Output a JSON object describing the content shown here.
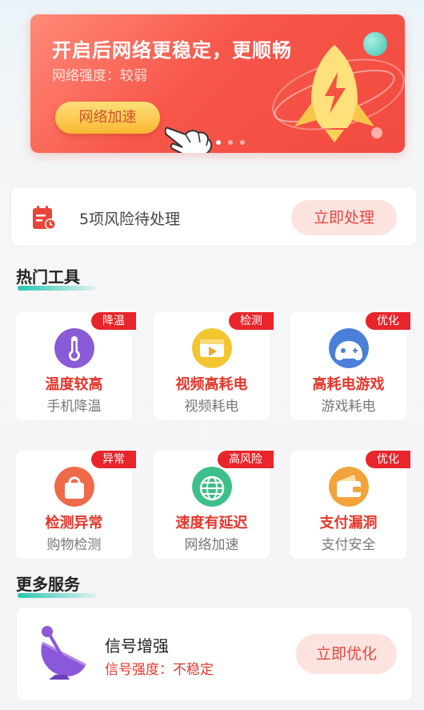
{
  "banner": {
    "title": "开启后网络更稳定，更顺畅",
    "subtitle": "网络强度：较弱",
    "button": "网络加速",
    "page_count": 3,
    "active_page": 1
  },
  "risk": {
    "text": "5项风险待处理",
    "button": "立即处理"
  },
  "sections": {
    "hot_tools": "热门工具",
    "more_services": "更多服务"
  },
  "tools": [
    {
      "tag": "降温",
      "name": "温度较高",
      "sub": "手机降温",
      "icon": "thermometer-icon",
      "color": "#8a5bd6"
    },
    {
      "tag": "检测",
      "name": "视频高耗电",
      "sub": "视频耗电",
      "icon": "video-icon",
      "color": "#f3c531"
    },
    {
      "tag": "优化",
      "name": "高耗电游戏",
      "sub": "游戏耗电",
      "icon": "gamepad-icon",
      "color": "#4a7fd9"
    },
    {
      "tag": "异常",
      "name": "检测异常",
      "sub": "购物检测",
      "icon": "shopping-bag-icon",
      "color": "#ee6a4a"
    },
    {
      "tag": "高风险",
      "name": "速度有延迟",
      "sub": "网络加速",
      "icon": "globe-icon",
      "color": "#3dbf8a"
    },
    {
      "tag": "优化",
      "name": "支付漏洞",
      "sub": "支付安全",
      "icon": "wallet-icon",
      "color": "#f2a33a"
    }
  ],
  "service": {
    "name": "信号增强",
    "status": "信号强度：不稳定",
    "button": "立即优化",
    "icon": "satellite-dish-icon"
  },
  "colors": {
    "accent_red": "#e5372c",
    "tag_red": "#e8252b",
    "banner_red": "#f7564a",
    "teal": "#25c7b0"
  }
}
